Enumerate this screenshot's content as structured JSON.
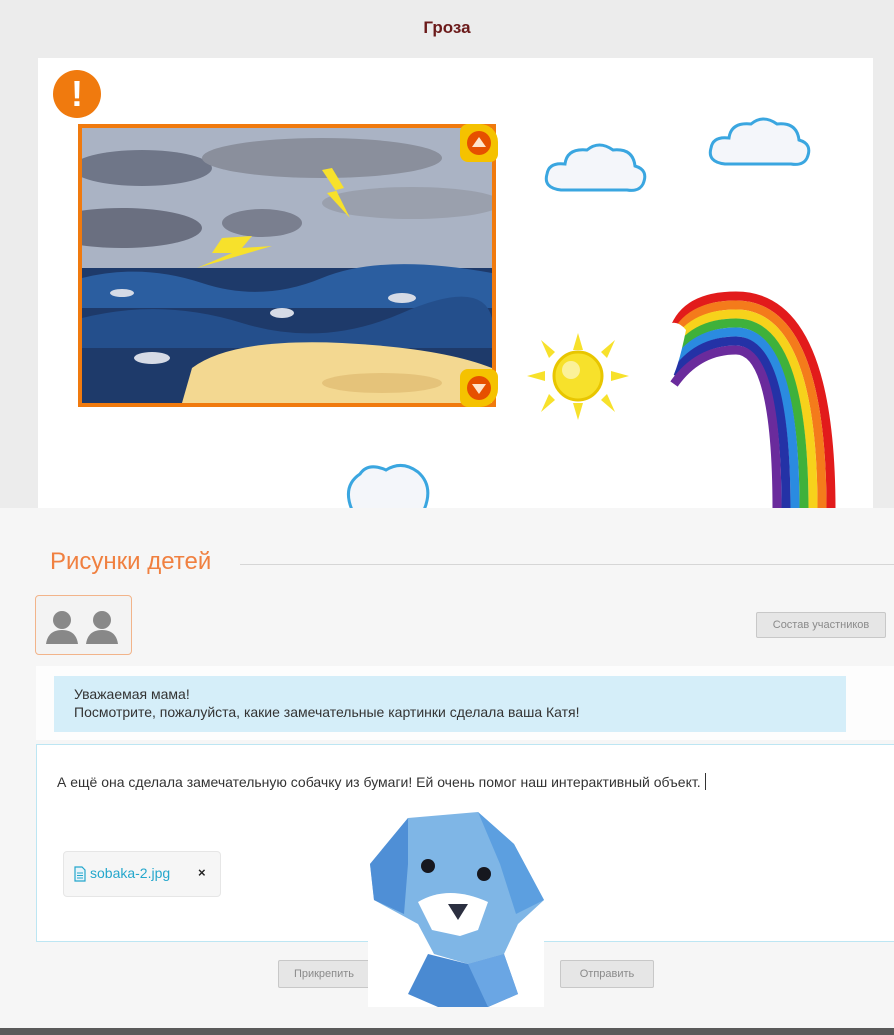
{
  "lesson": {
    "title": "Гроза"
  },
  "forum": {
    "section_title": "Рисунки детей",
    "members_button": "Состав участников",
    "message": {
      "line1": "Уважаемая мама!",
      "line2": "Посмотрите, пожалуйста, какие замечательные картинки сделала ваша Катя!"
    },
    "reply_text": "А ещё она сделала замечательную собачку из бумаги! Ей очень помог наш интерактивный объект.",
    "attachment": {
      "filename": "sobaka-2.jpg",
      "remove_label": "×"
    },
    "attach_button": "Прикрепить",
    "send_button": "Отправить"
  },
  "colors": {
    "accent_orange": "#f07a0e",
    "title_brown": "#6b1a1a",
    "section_orange": "#f08040",
    "link_blue": "#24a7cc",
    "message_bg": "#d5eef9"
  },
  "icons": [
    "alert-icon",
    "scroll-up-arrow-icon",
    "scroll-down-arrow-icon",
    "participants-icon",
    "file-icon"
  ]
}
